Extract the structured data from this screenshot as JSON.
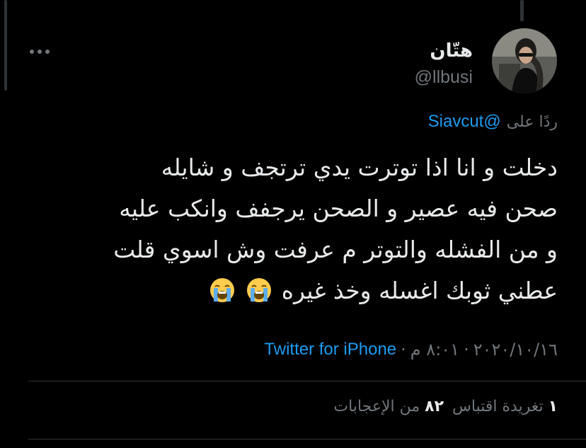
{
  "tweet": {
    "author": {
      "display_name": "هتّان",
      "handle": "@llbusi"
    },
    "reply": {
      "prefix": "ردًا على",
      "mention": "@Siavcut"
    },
    "text_lines": [
      "دخلت و انا اذا توترت يدي ترتجف و شايله",
      "صحن فيه عصير و الصحن يرجفف وانكب عليه",
      "و من الفشله والتوتر م عرفت وش اسوي قلت",
      "عطني ثوبك اغسله وخذ غيره"
    ],
    "emojis": [
      "loudly-crying-face-icon",
      "loudly-crying-face-icon"
    ],
    "meta": {
      "date": "٢٠٢٠/١٠/١٦",
      "sep1": "·",
      "time": "٨:٠١ م",
      "sep2": "·",
      "source": "Twitter for iPhone"
    },
    "stats": {
      "quote_count": "١",
      "quote_label": "تغريدة اقتباس",
      "like_count": "٨٢",
      "like_label": "من الإعجابات"
    }
  },
  "colors": {
    "background": "#000000",
    "text": "#e7e9ea",
    "muted": "#71767b",
    "accent": "#1d9bf0",
    "divider": "#2f3336"
  }
}
